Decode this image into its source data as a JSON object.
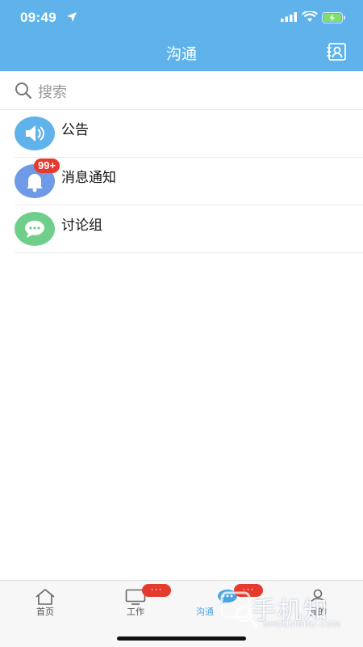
{
  "status_bar": {
    "time": "09:49"
  },
  "header": {
    "title": "沟通"
  },
  "search": {
    "placeholder": "搜索"
  },
  "list": [
    {
      "label": "公告",
      "icon": "speaker-icon",
      "color": "#5fb3ea"
    },
    {
      "label": "消息通知",
      "icon": "bell-icon",
      "color": "#6f9ae8",
      "badge": "99+"
    },
    {
      "label": "讨论组",
      "icon": "chat-bubble-icon",
      "color": "#6fcf8a"
    }
  ],
  "tabs": [
    {
      "label": "首页",
      "icon": "home-icon",
      "badge": ""
    },
    {
      "label": "工作",
      "icon": "monitor-icon",
      "badge": "···"
    },
    {
      "label": "沟通",
      "icon": "chat-icon",
      "badge": "···",
      "active": true
    },
    {
      "label": "我的",
      "icon": "user-icon",
      "badge": ""
    }
  ],
  "watermark": {
    "big": "手机知",
    "small": "SHOUJISHU.COM"
  },
  "colors": {
    "header": "#5fb3ea",
    "badge": "#e53b2e",
    "active_tab": "#4aa4e3"
  }
}
